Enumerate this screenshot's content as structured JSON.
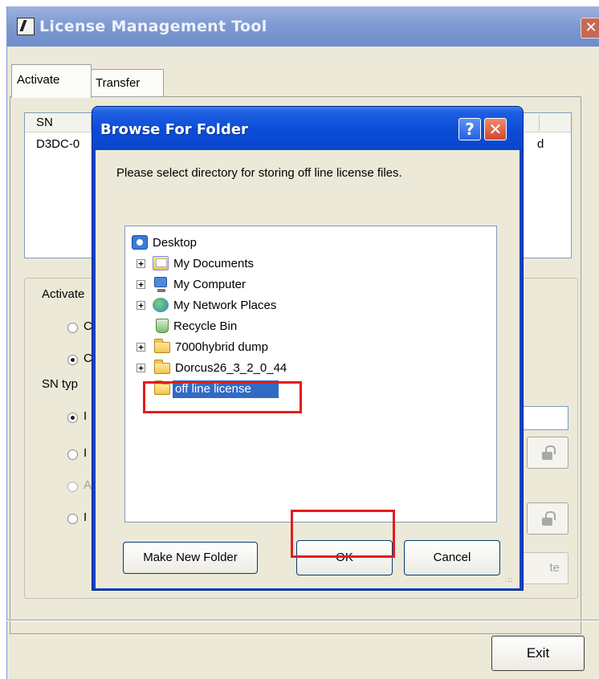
{
  "main_window": {
    "title": "License Management Tool",
    "close_glyph": "✕",
    "tabs": [
      "Activate",
      "Transfer"
    ],
    "list": {
      "header_sn": "SN",
      "row_sn": "D3DC-0",
      "row_tail": "d"
    },
    "activate_label": "Activate",
    "sn_type_label": "SN typ",
    "radios_top": [
      {
        "text": "C",
        "checked": false
      },
      {
        "text": "C",
        "checked": true
      }
    ],
    "radios_bottom": [
      {
        "text": "I",
        "checked": true
      },
      {
        "text": "I",
        "checked": false
      },
      {
        "text": "A",
        "checked": false
      },
      {
        "text": "I",
        "checked": false
      }
    ],
    "hidden_button_tail": "te",
    "exit_label": "Exit"
  },
  "dialog": {
    "title": "Browse For Folder",
    "help_glyph": "?",
    "close_glyph": "✕",
    "message": "Please select directory for storing off line license files.",
    "tree": [
      {
        "label": "Desktop",
        "icon": "desktop-icon",
        "expander": "",
        "depth": 0,
        "selected": false
      },
      {
        "label": "My Documents",
        "icon": "my-documents-icon",
        "expander": "+",
        "depth": 1,
        "selected": false
      },
      {
        "label": "My Computer",
        "icon": "computer-icon",
        "expander": "+",
        "depth": 1,
        "selected": false
      },
      {
        "label": "My Network Places",
        "icon": "network-places-icon",
        "expander": "+",
        "depth": 1,
        "selected": false
      },
      {
        "label": "Recycle Bin",
        "icon": "recycle-bin-icon",
        "expander": "",
        "depth": 1,
        "selected": false
      },
      {
        "label": "7000hybrid dump",
        "icon": "folder-icon",
        "expander": "+",
        "depth": 1,
        "selected": false
      },
      {
        "label": "Dorcus26_3_2_0_44",
        "icon": "folder-icon",
        "expander": "+",
        "depth": 1,
        "selected": false
      },
      {
        "label": "off line license",
        "icon": "folder-icon",
        "expander": "",
        "depth": 1,
        "selected": true
      }
    ],
    "make_new_folder_label": "Make New Folder",
    "ok_label": "OK",
    "cancel_label": "Cancel",
    "grip_glyph": ".::"
  },
  "colors": {
    "highlight_red": "#e31c1c",
    "xp_blue": "#0a43c8",
    "selection_blue": "#316ac5"
  }
}
